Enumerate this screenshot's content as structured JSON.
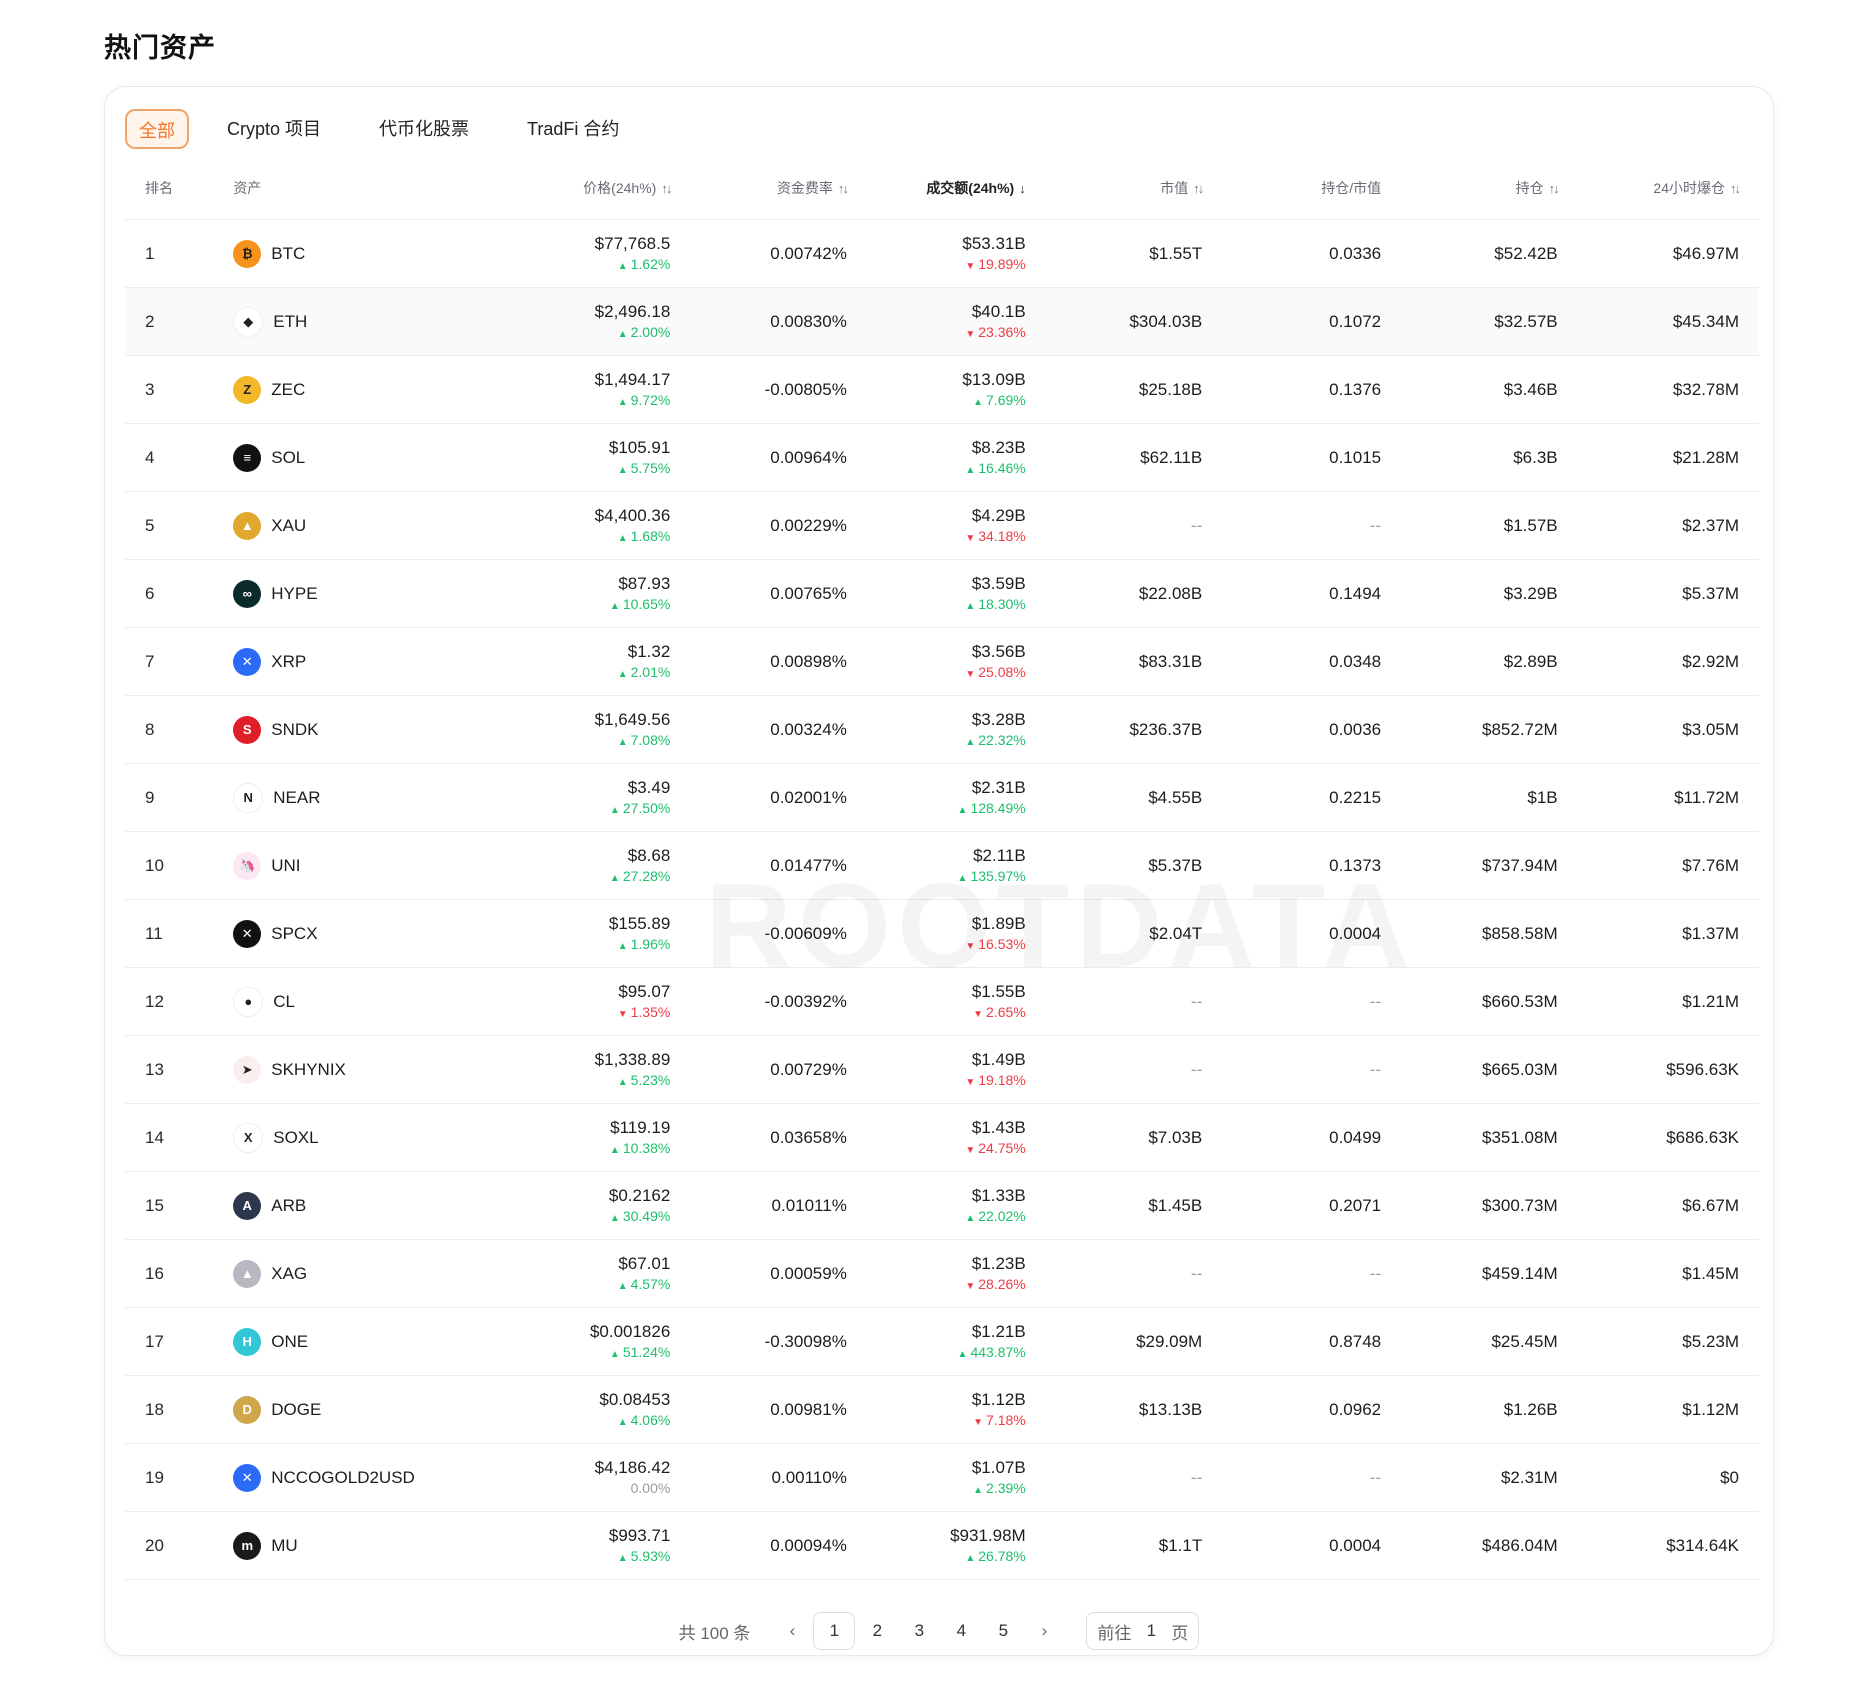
{
  "page_title": "热门资产",
  "tabs": [
    "全部",
    "Crypto 项目",
    "代币化股票",
    "TradFi 合约"
  ],
  "active_tab": "全部",
  "columns": {
    "rank": "排名",
    "asset": "资产",
    "price": "价格(24h%)",
    "funding": "资金费率",
    "volume": "成交额(24h%)",
    "mcap": "市值",
    "oi_mcap": "持仓/市值",
    "oi": "持仓",
    "liq": "24小时爆仓"
  },
  "rows": [
    {
      "rank": "1",
      "asset": "BTC",
      "icon": "bitcoin-icon",
      "icon_color": "#f7931a",
      "glyph": "₿",
      "price": "$77,768.5",
      "price_chg": "1.62%",
      "price_dir": "up",
      "funding": "0.00742%",
      "volume": "$53.31B",
      "vol_chg": "19.89%",
      "vol_dir": "down",
      "mcap": "$1.55T",
      "oi_mcap": "0.0336",
      "oi": "$52.42B",
      "liq": "$46.97M"
    },
    {
      "rank": "2",
      "asset": "ETH",
      "icon": "ethereum-icon",
      "icon_color": "#ffffff",
      "glyph": "◆",
      "price": "$2,496.18",
      "price_chg": "2.00%",
      "price_dir": "up",
      "funding": "0.00830%",
      "volume": "$40.1B",
      "vol_chg": "23.36%",
      "vol_dir": "down",
      "mcap": "$304.03B",
      "oi_mcap": "0.1072",
      "oi": "$32.57B",
      "liq": "$45.34M"
    },
    {
      "rank": "3",
      "asset": "ZEC",
      "icon": "zcash-icon",
      "icon_color": "#f4b728",
      "glyph": "Z",
      "price": "$1,494.17",
      "price_chg": "9.72%",
      "price_dir": "up",
      "funding": "-0.00805%",
      "volume": "$13.09B",
      "vol_chg": "7.69%",
      "vol_dir": "up",
      "mcap": "$25.18B",
      "oi_mcap": "0.1376",
      "oi": "$3.46B",
      "liq": "$32.78M"
    },
    {
      "rank": "4",
      "asset": "SOL",
      "icon": "solana-icon",
      "icon_color": "#111111",
      "glyph": "≡",
      "price": "$105.91",
      "price_chg": "5.75%",
      "price_dir": "up",
      "funding": "0.00964%",
      "volume": "$8.23B",
      "vol_chg": "16.46%",
      "vol_dir": "up",
      "mcap": "$62.11B",
      "oi_mcap": "0.1015",
      "oi": "$6.3B",
      "liq": "$21.28M"
    },
    {
      "rank": "5",
      "asset": "XAU",
      "icon": "gold-icon",
      "icon_color": "#e0a82e",
      "glyph": "▲",
      "price": "$4,400.36",
      "price_chg": "1.68%",
      "price_dir": "up",
      "funding": "0.00229%",
      "volume": "$4.29B",
      "vol_chg": "34.18%",
      "vol_dir": "down",
      "mcap": "--",
      "oi_mcap": "--",
      "oi": "$1.57B",
      "liq": "$2.37M"
    },
    {
      "rank": "6",
      "asset": "HYPE",
      "icon": "hyperliquid-icon",
      "icon_color": "#0b2b2b",
      "glyph": "∞",
      "price": "$87.93",
      "price_chg": "10.65%",
      "price_dir": "up",
      "funding": "0.00765%",
      "volume": "$3.59B",
      "vol_chg": "18.30%",
      "vol_dir": "up",
      "mcap": "$22.08B",
      "oi_mcap": "0.1494",
      "oi": "$3.29B",
      "liq": "$5.37M"
    },
    {
      "rank": "7",
      "asset": "XRP",
      "icon": "xrp-icon",
      "icon_color": "#2a6af5",
      "glyph": "✕",
      "price": "$1.32",
      "price_chg": "2.01%",
      "price_dir": "up",
      "funding": "0.00898%",
      "volume": "$3.56B",
      "vol_chg": "25.08%",
      "vol_dir": "down",
      "mcap": "$83.31B",
      "oi_mcap": "0.0348",
      "oi": "$2.89B",
      "liq": "$2.92M"
    },
    {
      "rank": "8",
      "asset": "SNDK",
      "icon": "sandisk-icon",
      "icon_color": "#e11d27",
      "glyph": "S",
      "price": "$1,649.56",
      "price_chg": "7.08%",
      "price_dir": "up",
      "funding": "0.00324%",
      "volume": "$3.28B",
      "vol_chg": "22.32%",
      "vol_dir": "up",
      "mcap": "$236.37B",
      "oi_mcap": "0.0036",
      "oi": "$852.72M",
      "liq": "$3.05M"
    },
    {
      "rank": "9",
      "asset": "NEAR",
      "icon": "near-icon",
      "icon_color": "#ffffff",
      "glyph": "N",
      "price": "$3.49",
      "price_chg": "27.50%",
      "price_dir": "up",
      "funding": "0.02001%",
      "volume": "$2.31B",
      "vol_chg": "128.49%",
      "vol_dir": "up",
      "mcap": "$4.55B",
      "oi_mcap": "0.2215",
      "oi": "$1B",
      "liq": "$11.72M"
    },
    {
      "rank": "10",
      "asset": "UNI",
      "icon": "uniswap-icon",
      "icon_color": "#fde7f3",
      "glyph": "🦄",
      "price": "$8.68",
      "price_chg": "27.28%",
      "price_dir": "up",
      "funding": "0.01477%",
      "volume": "$2.11B",
      "vol_chg": "135.97%",
      "vol_dir": "up",
      "mcap": "$5.37B",
      "oi_mcap": "0.1373",
      "oi": "$737.94M",
      "liq": "$7.76M"
    },
    {
      "rank": "11",
      "asset": "SPCX",
      "icon": "spacex-icon",
      "icon_color": "#111111",
      "glyph": "✕",
      "price": "$155.89",
      "price_chg": "1.96%",
      "price_dir": "up",
      "funding": "-0.00609%",
      "volume": "$1.89B",
      "vol_chg": "16.53%",
      "vol_dir": "down",
      "mcap": "$2.04T",
      "oi_mcap": "0.0004",
      "oi": "$858.58M",
      "liq": "$1.37M"
    },
    {
      "rank": "12",
      "asset": "CL",
      "icon": "oil-drop-icon",
      "icon_color": "#ffffff",
      "glyph": "●",
      "price": "$95.07",
      "price_chg": "1.35%",
      "price_dir": "down",
      "funding": "-0.00392%",
      "volume": "$1.55B",
      "vol_chg": "2.65%",
      "vol_dir": "down",
      "mcap": "--",
      "oi_mcap": "--",
      "oi": "$660.53M",
      "liq": "$1.21M"
    },
    {
      "rank": "13",
      "asset": "SKHYNIX",
      "icon": "skhynix-icon",
      "icon_color": "#fbeeee",
      "glyph": "➤",
      "price": "$1,338.89",
      "price_chg": "5.23%",
      "price_dir": "up",
      "funding": "0.00729%",
      "volume": "$1.49B",
      "vol_chg": "19.18%",
      "vol_dir": "down",
      "mcap": "--",
      "oi_mcap": "--",
      "oi": "$665.03M",
      "liq": "$596.63K"
    },
    {
      "rank": "14",
      "asset": "SOXL",
      "icon": "soxl-icon",
      "icon_color": "#ffffff",
      "glyph": "X",
      "price": "$119.19",
      "price_chg": "10.38%",
      "price_dir": "up",
      "funding": "0.03658%",
      "volume": "$1.43B",
      "vol_chg": "24.75%",
      "vol_dir": "down",
      "mcap": "$7.03B",
      "oi_mcap": "0.0499",
      "oi": "$351.08M",
      "liq": "$686.63K"
    },
    {
      "rank": "15",
      "asset": "ARB",
      "icon": "arbitrum-icon",
      "icon_color": "#2d374b",
      "glyph": "A",
      "price": "$0.2162",
      "price_chg": "30.49%",
      "price_dir": "up",
      "funding": "0.01011%",
      "volume": "$1.33B",
      "vol_chg": "22.02%",
      "vol_dir": "up",
      "mcap": "$1.45B",
      "oi_mcap": "0.2071",
      "oi": "$300.73M",
      "liq": "$6.67M"
    },
    {
      "rank": "16",
      "asset": "XAG",
      "icon": "silver-icon",
      "icon_color": "#b8b8c0",
      "glyph": "▲",
      "price": "$67.01",
      "price_chg": "4.57%",
      "price_dir": "up",
      "funding": "0.00059%",
      "volume": "$1.23B",
      "vol_chg": "28.26%",
      "vol_dir": "down",
      "mcap": "--",
      "oi_mcap": "--",
      "oi": "$459.14M",
      "liq": "$1.45M"
    },
    {
      "rank": "17",
      "asset": "ONE",
      "icon": "harmony-icon",
      "icon_color": "#32c7d6",
      "glyph": "H",
      "price": "$0.001826",
      "price_chg": "51.24%",
      "price_dir": "up",
      "funding": "-0.30098%",
      "volume": "$1.21B",
      "vol_chg": "443.87%",
      "vol_dir": "up",
      "mcap": "$29.09M",
      "oi_mcap": "0.8748",
      "oi": "$25.45M",
      "liq": "$5.23M"
    },
    {
      "rank": "18",
      "asset": "DOGE",
      "icon": "dogecoin-icon",
      "icon_color": "#cfa64a",
      "glyph": "D",
      "price": "$0.08453",
      "price_chg": "4.06%",
      "price_dir": "up",
      "funding": "0.00981%",
      "volume": "$1.12B",
      "vol_chg": "7.18%",
      "vol_dir": "down",
      "mcap": "$13.13B",
      "oi_mcap": "0.0962",
      "oi": "$1.26B",
      "liq": "$1.12M"
    },
    {
      "rank": "19",
      "asset": "NCCOGOLD2USD",
      "icon": "nccogold-icon",
      "icon_color": "#2a6af5",
      "glyph": "✕",
      "price": "$4,186.42",
      "price_chg": "0.00%",
      "price_dir": "flat",
      "funding": "0.00110%",
      "volume": "$1.07B",
      "vol_chg": "2.39%",
      "vol_dir": "up",
      "mcap": "--",
      "oi_mcap": "--",
      "oi": "$2.31M",
      "liq": "$0"
    },
    {
      "rank": "20",
      "asset": "MU",
      "icon": "micron-icon",
      "icon_color": "#1a1a1a",
      "glyph": "m",
      "price": "$993.71",
      "price_chg": "5.93%",
      "price_dir": "up",
      "funding": "0.00094%",
      "volume": "$931.98M",
      "vol_chg": "26.78%",
      "vol_dir": "up",
      "mcap": "$1.1T",
      "oi_mcap": "0.0004",
      "oi": "$486.04M",
      "liq": "$314.64K"
    }
  ],
  "pagination": {
    "total": "共 100 条",
    "pages": [
      "1",
      "2",
      "3",
      "4",
      "5"
    ],
    "current": "1",
    "prev": "‹",
    "next": "›",
    "goto_label": "前往",
    "goto_value": "1",
    "goto_suffix": "页"
  },
  "watermark": "ROOTDATA",
  "colors": {
    "accent": "#f0782a",
    "up": "#1cbf6b",
    "down": "#ef3b46"
  }
}
